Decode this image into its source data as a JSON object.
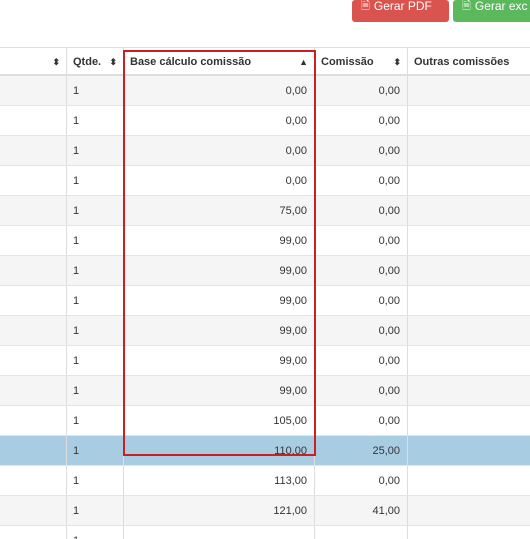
{
  "toolbar": {
    "pdf_label": "Gerar PDF",
    "excel_label": "Gerar exc",
    "pdf_icon": "file-pdf-icon",
    "excel_icon": "file-excel-icon"
  },
  "table": {
    "headers": [
      "",
      "Qtde.",
      "Base cálculo comissão",
      "Comissão",
      "Outras comissões"
    ],
    "rows": [
      {
        "qtde": "1",
        "base": "0,00",
        "comissao": "0,00",
        "outras": ""
      },
      {
        "qtde": "1",
        "base": "0,00",
        "comissao": "0,00",
        "outras": ""
      },
      {
        "qtde": "1",
        "base": "0,00",
        "comissao": "0,00",
        "outras": ""
      },
      {
        "qtde": "1",
        "base": "0,00",
        "comissao": "0,00",
        "outras": ""
      },
      {
        "qtde": "1",
        "base": "75,00",
        "comissao": "0,00",
        "outras": ""
      },
      {
        "qtde": "1",
        "base": "99,00",
        "comissao": "0,00",
        "outras": ""
      },
      {
        "qtde": "1",
        "base": "99,00",
        "comissao": "0,00",
        "outras": ""
      },
      {
        "qtde": "1",
        "base": "99,00",
        "comissao": "0,00",
        "outras": ""
      },
      {
        "qtde": "1",
        "base": "99,00",
        "comissao": "0,00",
        "outras": ""
      },
      {
        "qtde": "1",
        "base": "99,00",
        "comissao": "0,00",
        "outras": ""
      },
      {
        "qtde": "1",
        "base": "99,00",
        "comissao": "0,00",
        "outras": ""
      },
      {
        "qtde": "1",
        "base": "105,00",
        "comissao": "0,00",
        "outras": ""
      },
      {
        "qtde": "1",
        "base": "110,00",
        "comissao": "25,00",
        "outras": "",
        "selected": true
      },
      {
        "qtde": "1",
        "base": "113,00",
        "comissao": "0,00",
        "outras": ""
      },
      {
        "qtde": "1",
        "base": "121,00",
        "comissao": "41,00",
        "outras": ""
      },
      {
        "qtde": "1",
        "base": "",
        "comissao": "",
        "outras": ""
      }
    ]
  },
  "colors": {
    "pdf_button": "#d9534f",
    "excel_button": "#5cb85c",
    "selected_row": "#a8cde3",
    "highlight_border": "#cc1f1f"
  }
}
